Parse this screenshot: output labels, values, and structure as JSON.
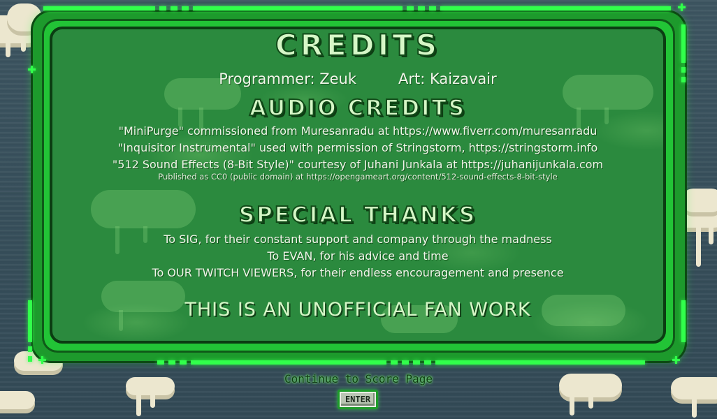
{
  "credits": {
    "title": "CREDITS",
    "programmer": "Programmer: Zeuk",
    "art": "Art: Kaizavair",
    "audio_title": "AUDIO CREDITS",
    "audio_lines": [
      "\"MiniPurge\" commissioned from Muresanradu at https://www.fiverr.com/muresanradu",
      "\"Inquisitor Instrumental\" used with permission of Stringstorm, https://stringstorm.info",
      "\"512 Sound Effects (8-Bit Style)\" courtesy of Juhani Junkala at https://juhanijunkala.com"
    ],
    "audio_note": "Published as CC0 (public domain) at https://opengameart.org/content/512-sound-effects-8-bit-style",
    "thanks_title": "SPECIAL THANKS",
    "thanks_lines": [
      "To SIG, for their constant support and company through the madness",
      "To EVAN, for his advice and time",
      "To OUR TWITCH VIEWERS, for their endless encouragement and presence"
    ],
    "disclaimer": "THIS IS AN UNOFFICIAL FAN WORK"
  },
  "footer": {
    "continue_label": "Continue to Score Page",
    "enter_key": "ENTER"
  },
  "colors": {
    "panel": "#2b8a3e",
    "frame": "#22c436",
    "neon": "#31ff4b",
    "sea": "#3d5561"
  }
}
